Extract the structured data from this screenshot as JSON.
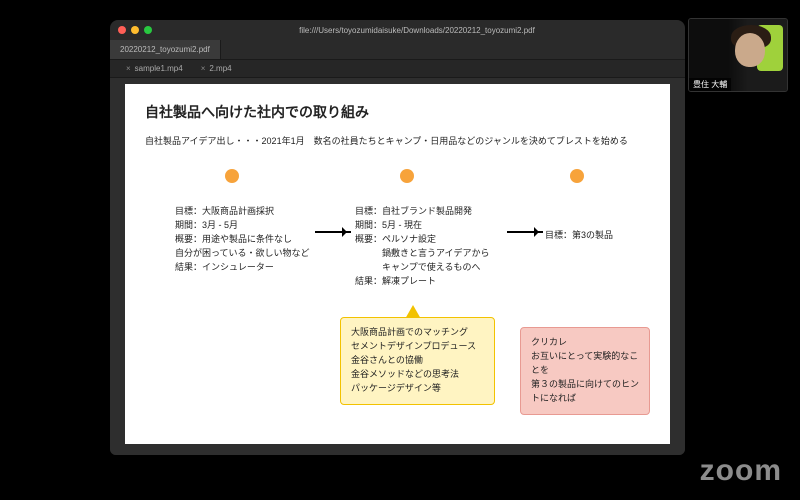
{
  "window": {
    "path": "file:///Users/toyozumidaisuke/Downloads/20220212_toyozumi2.pdf",
    "tabs": [
      {
        "label": "20220212_toyozumi2.pdf",
        "active": true
      }
    ],
    "subtabs": [
      {
        "label": "sample1.mp4"
      },
      {
        "label": "2.mp4"
      }
    ]
  },
  "slide": {
    "title": "自社製品へ向けた社内での取り組み",
    "subtitle": "自社製品アイデア出し・・・2021年1月　数名の社員たちとキャンプ・日用品などのジャンルを決めてブレストを始める",
    "phase1": "目標：大阪商品計画採択\n期間：3月 - 5月\n概要：用途や製品に条件なし\n自分が困っている・欲しい物など\n結果：インシュレーター",
    "phase2": "目標：自社ブランド製品開発\n期間：5月 - 現在\n概要：ペルソナ設定\n　　　鍋敷きと言うアイデアから\n　　　キャンプで使えるものへ\n結果：解凍プレート",
    "phase3": "目標：第3の製品",
    "note_yellow": "大阪商品計画でのマッチング\nセメントデザインプロデュース\n金谷さんとの協働\n金谷メソッドなどの思考法\nパッケージデザイン等",
    "note_pink": "クリカレ\nお互いにとって実験的なことを\n第３の製品に向けてのヒントになれば"
  },
  "participant": {
    "name": "豊住 大輔"
  },
  "watermark": "zoom"
}
